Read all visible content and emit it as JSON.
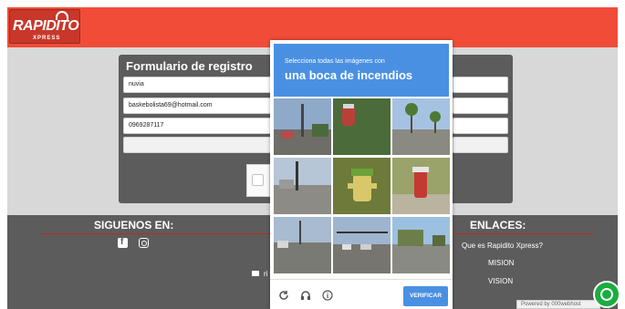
{
  "brand": {
    "logo_main": "RAPIDITO",
    "logo_sub": "XPRESS"
  },
  "form": {
    "title": "Formulario de registro",
    "name_value": "nuvia",
    "email_value": "baskebolista69@hotmail.com",
    "phone_value": "0969287117",
    "empty_value": ""
  },
  "challenge": {
    "line1": "Selecciona todas las imágenes con",
    "line2": "una boca de incendios",
    "verify_label": "VERIFICAR",
    "icons": [
      "reload-icon",
      "headphones-icon",
      "info-icon"
    ]
  },
  "footer": {
    "social_heading": "SIGUENOS EN:",
    "links_heading": "ENLACES:",
    "links": [
      "Que es Rapidito Xpress?",
      "MISION",
      "VISION"
    ],
    "mail_text_partial": "ri"
  },
  "badge": {
    "powered_by": "Powered by  000webhost"
  },
  "colors": {
    "brand_red": "#f14c37",
    "panel_gray": "#5c5c5c",
    "accent_blue": "#4a90e2",
    "whatsapp_green": "#1aad3f"
  }
}
